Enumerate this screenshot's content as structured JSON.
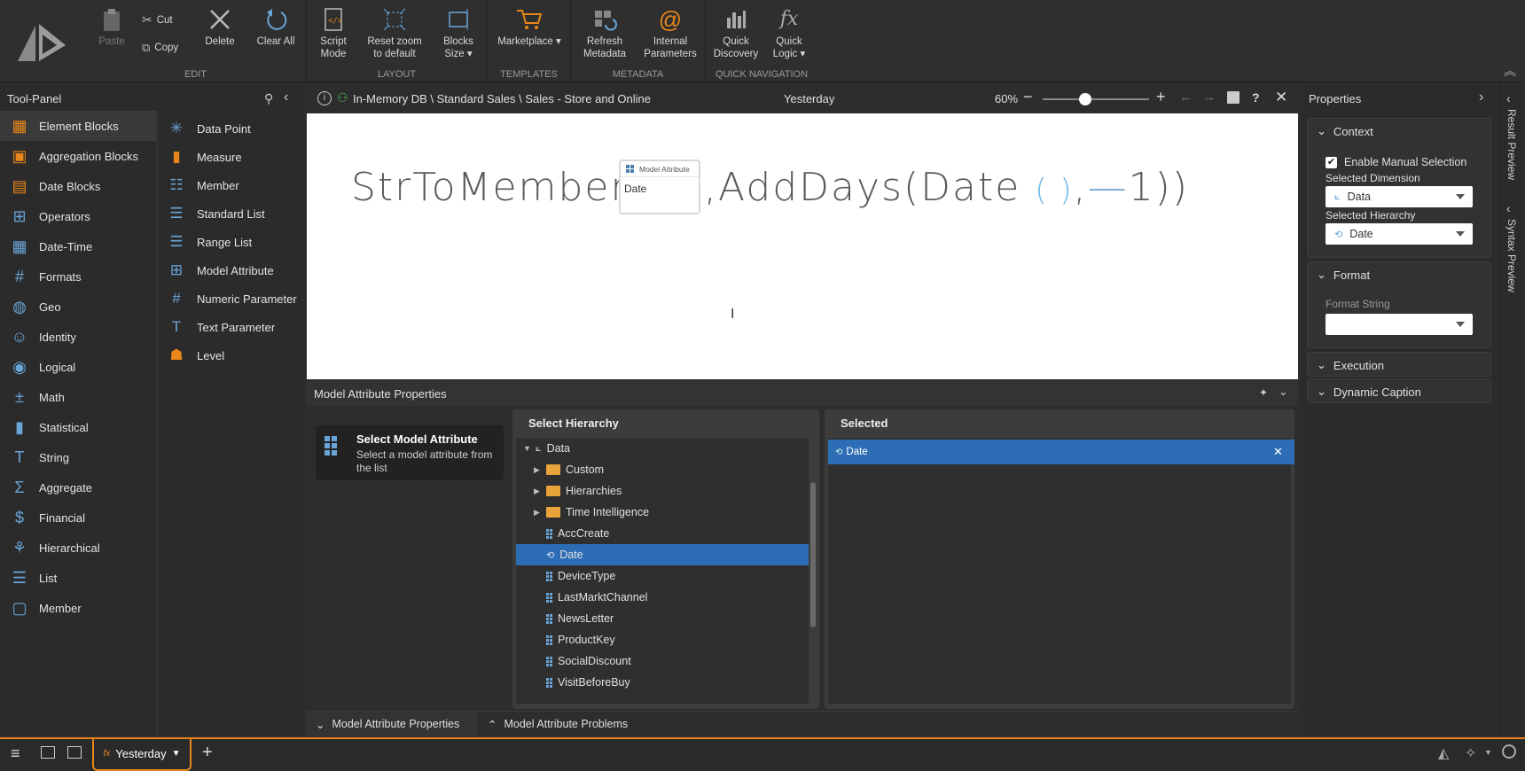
{
  "ribbon": {
    "groups": {
      "edit": "EDIT",
      "layout": "LAYOUT",
      "templates": "TEMPLATES",
      "metadata": "METADATA",
      "quick_navigation": "QUICK NAVIGATION"
    },
    "paste": "Paste",
    "cut": "Cut",
    "copy": "Copy",
    "delete": "Delete",
    "clear_all": "Clear All",
    "script_mode_1": "Script",
    "script_mode_2": "Mode",
    "reset_zoom_1": "Reset zoom",
    "reset_zoom_2": "to default",
    "blocks_size_1": "Blocks",
    "blocks_size_2": "Size ▾",
    "marketplace": "Marketplace ▾",
    "refresh_metadata_1": "Refresh",
    "refresh_metadata_2": "Metadata",
    "internal_params_1": "Internal",
    "internal_params_2": "Parameters",
    "quick_discovery_1": "Quick",
    "quick_discovery_2": "Discovery",
    "quick_logic_1": "Quick",
    "quick_logic_2": "Logic ▾"
  },
  "toolpanel": {
    "title": "Tool-Panel",
    "categories": [
      {
        "label": "Element Blocks",
        "icon": "element-blocks-icon"
      },
      {
        "label": "Aggregation Blocks",
        "icon": "aggregation-blocks-icon"
      },
      {
        "label": "Date Blocks",
        "icon": "date-blocks-icon"
      },
      {
        "label": "Operators",
        "icon": "operators-icon"
      },
      {
        "label": "Date-Time",
        "icon": "date-time-icon"
      },
      {
        "label": "Formats",
        "icon": "formats-icon"
      },
      {
        "label": "Geo",
        "icon": "geo-icon"
      },
      {
        "label": "Identity",
        "icon": "identity-icon"
      },
      {
        "label": "Logical",
        "icon": "logical-icon"
      },
      {
        "label": "Math",
        "icon": "math-icon"
      },
      {
        "label": "Statistical",
        "icon": "statistical-icon"
      },
      {
        "label": "String",
        "icon": "string-icon"
      },
      {
        "label": "Aggregate",
        "icon": "aggregate-icon"
      },
      {
        "label": "Financial",
        "icon": "financial-icon"
      },
      {
        "label": "Hierarchical",
        "icon": "hierarchical-icon"
      },
      {
        "label": "List",
        "icon": "list-icon"
      },
      {
        "label": "Member",
        "icon": "member-icon"
      }
    ],
    "elements": [
      {
        "label": "Data Point"
      },
      {
        "label": "Measure"
      },
      {
        "label": "Member"
      },
      {
        "label": "Standard List"
      },
      {
        "label": "Range List"
      },
      {
        "label": "Model Attribute"
      },
      {
        "label": "Numeric Parameter"
      },
      {
        "label": "Text Parameter"
      },
      {
        "label": "Level"
      }
    ]
  },
  "canvas": {
    "breadcrumb": "In-Memory DB \\ Standard Sales \\ Sales - Store and Online",
    "title": "Yesterday",
    "zoom": "60%",
    "zoom_fraction": 0.4,
    "formula_prefix": "StrToMember(",
    "block_header": "Model Attribute",
    "block_value": "Date",
    "formula_mid": ",AddDays(Date",
    "formula_parens": "( )",
    "formula_end_comma": ",",
    "formula_minus": "—",
    "formula_tail": "1))"
  },
  "map": {
    "title": "Model Attribute Properties",
    "select_title": "Select Model Attribute",
    "select_desc": "Select a model attribute from the list",
    "hierarchy_title": "Select Hierarchy",
    "selected_title": "Selected",
    "selected_value": "Date",
    "tree": {
      "root": "Data",
      "folders": [
        "Custom",
        "Hierarchies",
        "Time Intelligence"
      ],
      "items": [
        "AccCreate",
        "Date",
        "DeviceType",
        "LastMarktChannel",
        "NewsLetter",
        "ProductKey",
        "SocialDiscount",
        "VisitBeforeBuy"
      ]
    }
  },
  "bottom": {
    "tab1": "Model Attribute Properties",
    "tab2": "Model Attribute Problems"
  },
  "props": {
    "title": "Properties",
    "context": "Context",
    "enable_manual": "Enable Manual Selection",
    "selected_dimension_label": "Selected Dimension",
    "selected_dimension": "Data",
    "selected_hierarchy_label": "Selected Hierarchy",
    "selected_hierarchy": "Date",
    "format": "Format",
    "format_string_label": "Format String",
    "execution": "Execution",
    "dynamic_caption": "Dynamic Caption"
  },
  "side": {
    "result_preview": "Result Preview",
    "syntax_preview": "Syntax Preview"
  },
  "taskbar": {
    "tab": "Yesterday"
  },
  "colors": {
    "accent": "#e8861a",
    "selection": "#2d6db5",
    "icon_blue": "#6aa5d8"
  }
}
